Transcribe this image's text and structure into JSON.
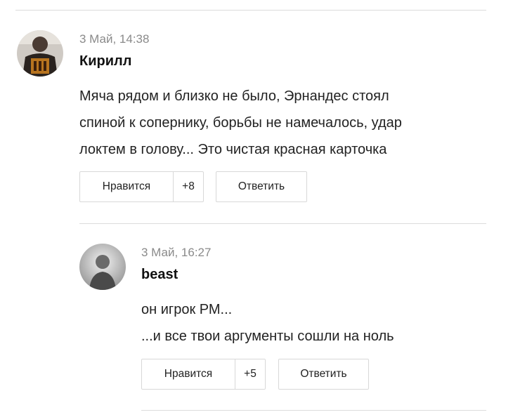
{
  "comments": [
    {
      "date": "3 Май, 14:38",
      "author": "Кирилл",
      "text_lines": [
        "Мяча рядом и близко не было, Эрнандес стоял",
        "спиной к сопернику, борьбы не намечалось, удар",
        "локтем в голову... Это чистая красная карточка"
      ],
      "like_label": "Нравится",
      "like_count": "+8",
      "reply_label": "Ответить",
      "avatar_icon": "user-avatar-photo"
    },
    {
      "date": "3 Май, 16:27",
      "author": "beast",
      "text_lines": [
        "он игрок РМ...",
        "...и все твои аргументы сошли на ноль"
      ],
      "like_label": "Нравится",
      "like_count": "+5",
      "reply_label": "Ответить",
      "avatar_icon": "user-avatar-photo"
    }
  ]
}
